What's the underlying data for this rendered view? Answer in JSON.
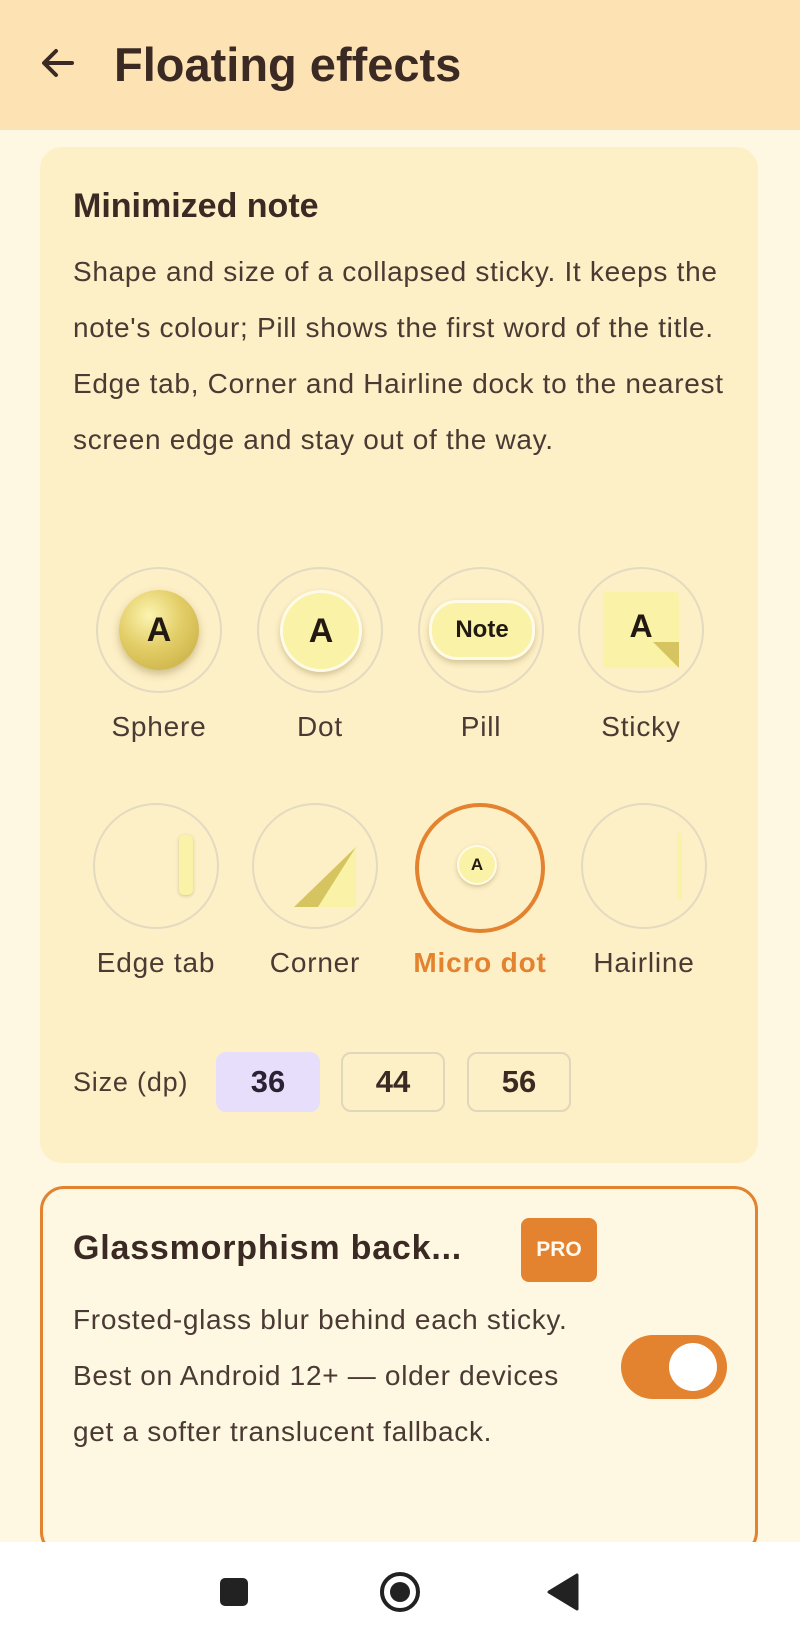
{
  "header": {
    "title": "Floating effects",
    "back_icon": "arrow-left-icon"
  },
  "minimized_note": {
    "title": "Minimized note",
    "description": "Shape and size of a collapsed sticky. It keeps the note's colour; Pill shows the first word of the title. Edge tab, Corner and Hairline dock to the nearest screen edge and stay out of the way.",
    "options": [
      {
        "label": "Sphere",
        "glyph": "A",
        "selected": false
      },
      {
        "label": "Dot",
        "glyph": "A",
        "selected": false
      },
      {
        "label": "Pill",
        "glyph": "Note",
        "selected": false
      },
      {
        "label": "Sticky",
        "glyph": "A",
        "selected": false
      },
      {
        "label": "Edge tab",
        "selected": false
      },
      {
        "label": "Corner",
        "selected": false
      },
      {
        "label": "Micro dot",
        "glyph": "A",
        "selected": true
      },
      {
        "label": "Hairline",
        "selected": false
      }
    ],
    "size_label": "Size (dp)",
    "sizes": [
      "36",
      "44",
      "56"
    ],
    "selected_size": "36"
  },
  "glassmorphism": {
    "title": "Glassmorphism back...",
    "badge": "PRO",
    "description": "Frosted-glass blur behind each sticky. Best on Android 12+ — older devices get a softer translucent fallback.",
    "enabled": true
  },
  "colors": {
    "accent": "#e3822f",
    "header_bg": "#fde3b4",
    "card_bg": "#fdefc6",
    "note_yellow": "#faf2a6",
    "selected_chip": "#e7defb"
  },
  "navbar": {
    "icons": [
      "recents-square-icon",
      "home-circle-icon",
      "back-triangle-icon"
    ]
  }
}
